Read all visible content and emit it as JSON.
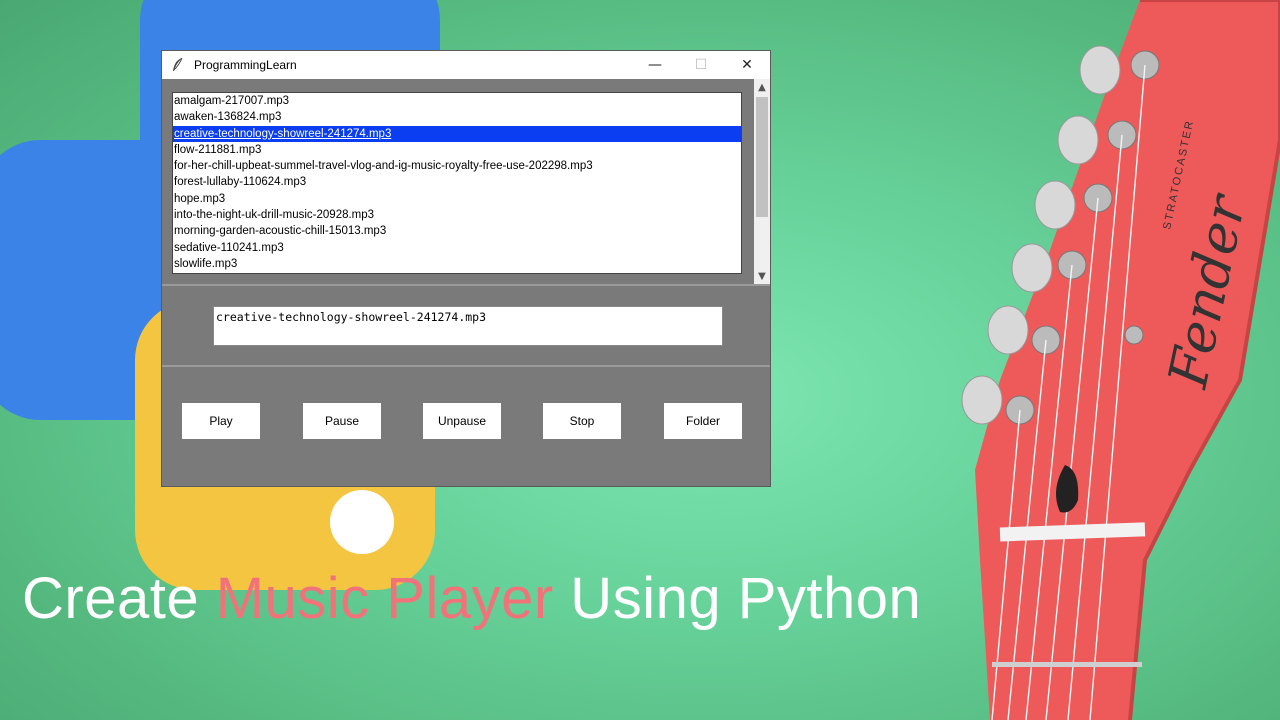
{
  "window": {
    "title": "ProgrammingLearn",
    "controls": {
      "minimize": "—",
      "maximize": "☐",
      "close": "✕"
    }
  },
  "playlist": {
    "items": [
      "amalgam-217007.mp3",
      "awaken-136824.mp3",
      "creative-technology-showreel-241274.mp3",
      "flow-211881.mp3",
      "for-her-chill-upbeat-summel-travel-vlog-and-ig-music-royalty-free-use-202298.mp3",
      "forest-lullaby-110624.mp3",
      "hope.mp3",
      "into-the-night-uk-drill-music-20928.mp3",
      "morning-garden-acoustic-chill-15013.mp3",
      "sedative-110241.mp3",
      "slowlife.mp3"
    ],
    "selected_index": 2
  },
  "now_playing": "creative-technology-showreel-241274.mp3",
  "buttons": {
    "play": "Play",
    "pause": "Pause",
    "unpause": "Unpause",
    "stop": "Stop",
    "folder": "Folder"
  },
  "caption": {
    "part1": "Create ",
    "accent": "Music Player",
    "part2": " Using Python"
  },
  "guitar_logo": "Fender",
  "guitar_model": "STRATOCASTER",
  "colors": {
    "background": "#68d49c",
    "selection": "#0a3ef0",
    "accent_text": "#f2727a",
    "window_body": "#7a7a7a"
  }
}
